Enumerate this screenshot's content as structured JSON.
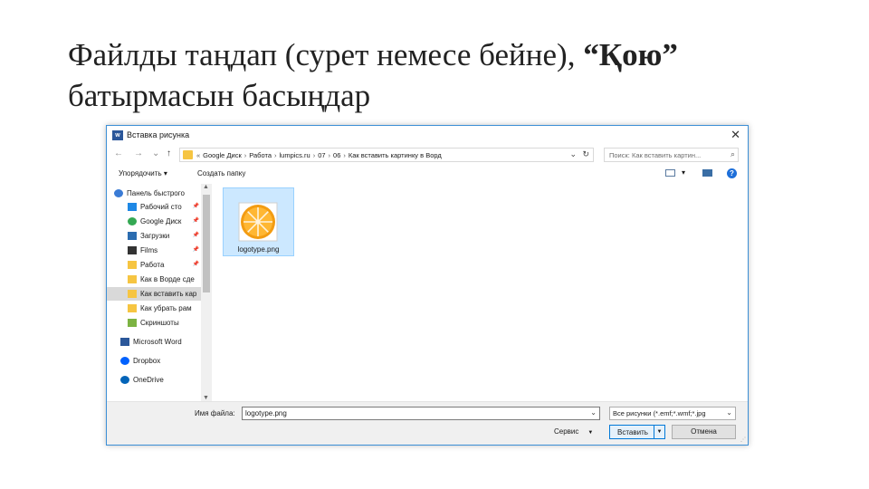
{
  "slide": {
    "title_main": "Файлды таңдап (сурет немесе бейне), ",
    "title_quote": "“Қою”",
    "title_end": " батырмасын басыңдар"
  },
  "dialog": {
    "app_icon": "w",
    "title": "Вставка рисунка",
    "close": "✕",
    "nav": {
      "back": "←",
      "forward": "→",
      "recent": "⌄",
      "up": "↑"
    },
    "address": {
      "crumbs": [
        "«",
        "Google Диск",
        "›",
        "Работа",
        "›",
        "lumpics.ru",
        "›",
        "07",
        "›",
        "06",
        "›",
        "Как вставить картинку в Ворд"
      ],
      "dropdown": "⌄",
      "refresh": "↻"
    },
    "search": {
      "placeholder": "Поиск: Как вставить картин...",
      "icon": "⌕"
    },
    "toolbar": {
      "organize": "Упорядочить ▾",
      "new_folder": "Создать папку",
      "view_arrow": "▾",
      "help": "?"
    },
    "nav_pane": {
      "items": [
        {
          "label": "Панель быстрого",
          "icon": "star-icon",
          "color": "#3a7bd5",
          "pin": ""
        },
        {
          "label": "Рабочий сто",
          "icon": "desktop-icon",
          "color": "#1e88e5",
          "pin": "📌"
        },
        {
          "label": "Google Диск",
          "icon": "google-drive-icon",
          "color": "#34a853",
          "pin": "📌"
        },
        {
          "label": "Загрузки",
          "icon": "downloads-icon",
          "color": "#2b6cb0",
          "pin": "📌"
        },
        {
          "label": "Films",
          "icon": "films-icon",
          "color": "#333333",
          "pin": "📌"
        },
        {
          "label": "Работа",
          "icon": "folder-icon",
          "color": "#f6c542",
          "pin": "📌"
        },
        {
          "label": "Как в Ворде сде",
          "icon": "folder-icon",
          "color": "#f6c542",
          "pin": ""
        },
        {
          "label": "Как вставить кар",
          "icon": "folder-icon",
          "color": "#f6c542",
          "pin": ""
        },
        {
          "label": "Как убрать рам",
          "icon": "folder-icon",
          "color": "#f6c542",
          "pin": ""
        },
        {
          "label": "Скриншоты",
          "icon": "screenshots-icon",
          "color": "#7cb342",
          "pin": ""
        },
        {
          "label": "Microsoft Word",
          "icon": "word-icon",
          "color": "#2b579a",
          "pin": ""
        },
        {
          "label": "Dropbox",
          "icon": "dropbox-icon",
          "color": "#0061fe",
          "pin": ""
        },
        {
          "label": "OneDrive",
          "icon": "onedrive-icon",
          "color": "#0364b8",
          "pin": ""
        }
      ],
      "scroll_up": "▲",
      "scroll_down": "▼"
    },
    "file": {
      "name": "logotype.png"
    },
    "bottom": {
      "filename_label": "Имя файла:",
      "filename_value": "logotype.png",
      "filter_value": "Все рисунки (*.emf;*.wmf;*.jpg",
      "dropdown": "⌄",
      "service": "Сервис",
      "service_arrow": "▼",
      "insert": "Вставить",
      "insert_arrow": "▼",
      "cancel": "Отмена",
      "grip": "⋰"
    }
  }
}
